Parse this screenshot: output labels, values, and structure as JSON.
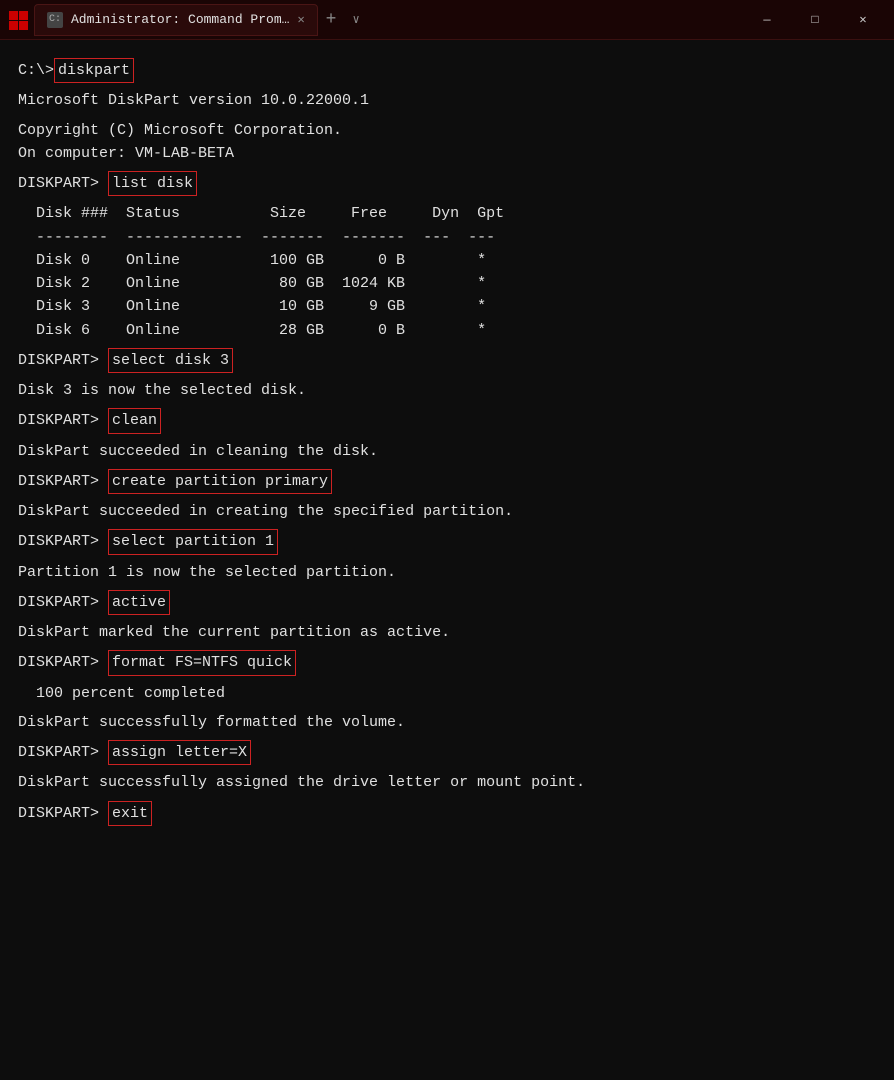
{
  "titlebar": {
    "icon": "⊞",
    "tab_label": "Administrator: Command Prom…",
    "new_tab": "+",
    "dropdown": "∨",
    "minimize": "—",
    "maximize": "□",
    "close": "✕"
  },
  "terminal": {
    "prompt_prefix": "DISKPART> ",
    "lines": [
      {
        "type": "prompt_cmd",
        "prompt": "C:\\>",
        "cmd": "diskpart"
      },
      {
        "type": "blank"
      },
      {
        "type": "output",
        "text": "Microsoft DiskPart version 10.0.22000.1"
      },
      {
        "type": "blank"
      },
      {
        "type": "output",
        "text": "Copyright (C) Microsoft Corporation."
      },
      {
        "type": "output",
        "text": "On computer: VM-LAB-BETA"
      },
      {
        "type": "blank"
      },
      {
        "type": "diskpart_cmd",
        "cmd": "list disk"
      },
      {
        "type": "blank"
      },
      {
        "type": "table_header"
      },
      {
        "type": "table_sep"
      },
      {
        "type": "disk_row",
        "num": "Disk 0",
        "status": "Online",
        "size": "100 GB",
        "free": "0 B",
        "dyn": "",
        "gpt": "*"
      },
      {
        "type": "disk_row",
        "num": "Disk 2",
        "status": "Online",
        "size": "80 GB",
        "free": "1024 KB",
        "dyn": "",
        "gpt": "*"
      },
      {
        "type": "disk_row",
        "num": "Disk 3",
        "status": "Online",
        "size": "10 GB",
        "free": "9 GB",
        "dyn": "",
        "gpt": "*"
      },
      {
        "type": "disk_row",
        "num": "Disk 6",
        "status": "Online",
        "size": "28 GB",
        "free": "0 B",
        "dyn": "",
        "gpt": "*"
      },
      {
        "type": "blank"
      },
      {
        "type": "diskpart_cmd",
        "cmd": "select disk 3"
      },
      {
        "type": "blank"
      },
      {
        "type": "output",
        "text": "Disk 3 is now the selected disk."
      },
      {
        "type": "blank"
      },
      {
        "type": "diskpart_cmd",
        "cmd": "clean"
      },
      {
        "type": "blank"
      },
      {
        "type": "output",
        "text": "DiskPart succeeded in cleaning the disk."
      },
      {
        "type": "blank"
      },
      {
        "type": "diskpart_cmd",
        "cmd": "create partition primary"
      },
      {
        "type": "blank"
      },
      {
        "type": "output",
        "text": "DiskPart succeeded in creating the specified partition."
      },
      {
        "type": "blank"
      },
      {
        "type": "diskpart_cmd",
        "cmd": "select partition 1"
      },
      {
        "type": "blank"
      },
      {
        "type": "output",
        "text": "Partition 1 is now the selected partition."
      },
      {
        "type": "blank"
      },
      {
        "type": "diskpart_cmd",
        "cmd": "active"
      },
      {
        "type": "blank"
      },
      {
        "type": "output",
        "text": "DiskPart marked the current partition as active."
      },
      {
        "type": "blank"
      },
      {
        "type": "diskpart_cmd",
        "cmd": "format FS=NTFS quick"
      },
      {
        "type": "blank"
      },
      {
        "type": "output",
        "text": "  100 percent completed"
      },
      {
        "type": "blank"
      },
      {
        "type": "output",
        "text": "DiskPart successfully formatted the volume."
      },
      {
        "type": "blank"
      },
      {
        "type": "diskpart_cmd",
        "cmd": "assign letter=X"
      },
      {
        "type": "blank"
      },
      {
        "type": "output",
        "text": "DiskPart successfully assigned the drive letter or mount point."
      },
      {
        "type": "blank"
      },
      {
        "type": "diskpart_cmd",
        "cmd": "exit"
      }
    ]
  }
}
